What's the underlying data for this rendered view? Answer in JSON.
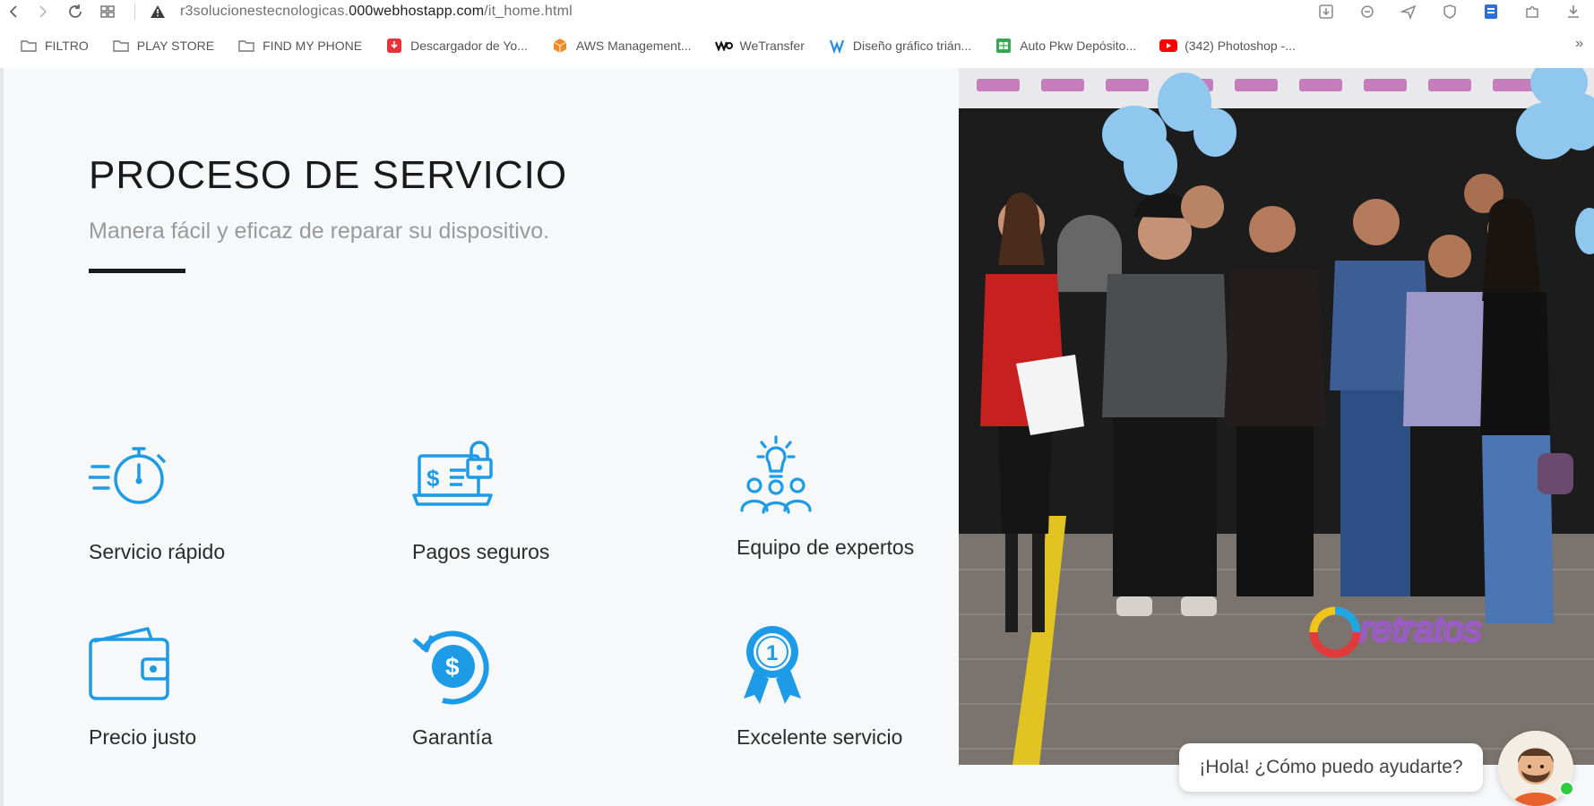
{
  "browser": {
    "url_prefix": "r3solucionestecnologicas.",
    "url_host": "000webhostapp.com",
    "url_path": "/it_home.html",
    "bookmarks": [
      {
        "label": "FILTRO",
        "icon": "folder-icon"
      },
      {
        "label": "PLAY STORE",
        "icon": "folder-icon"
      },
      {
        "label": "FIND MY PHONE",
        "icon": "folder-icon"
      },
      {
        "label": "Descargador de Yo...",
        "icon": "downloader-app-icon"
      },
      {
        "label": "AWS Management...",
        "icon": "aws-cube-icon"
      },
      {
        "label": "WeTransfer",
        "icon": "wetransfer-icon"
      },
      {
        "label": "Diseño gráfico trián...",
        "icon": "design-logo-icon"
      },
      {
        "label": "Auto Pkw Depósito...",
        "icon": "sheet-icon"
      },
      {
        "label": "(342) Photoshop -...",
        "icon": "youtube-icon"
      }
    ],
    "more_label": "»"
  },
  "section": {
    "title": "PROCESO DE SERVICIO",
    "subtitle": "Manera fácil y eficaz de reparar su dispositivo."
  },
  "features": [
    {
      "label": "Servicio rápido",
      "icon": "stopwatch-icon"
    },
    {
      "label": "Pagos seguros",
      "icon": "secure-payment-laptop-icon"
    },
    {
      "label": "Equipo de expertos",
      "icon": "expert-team-icon"
    },
    {
      "label": "Precio justo",
      "icon": "wallet-icon"
    },
    {
      "label": "Garantía",
      "icon": "guarantee-dollar-icon"
    },
    {
      "label": "Excelente servicio",
      "icon": "award-ribbon-icon"
    }
  ],
  "photo": {
    "watermark": "retratos"
  },
  "chat": {
    "message": "¡Hola! ¿Cómo puedo ayudarte?"
  },
  "colors": {
    "accent": "#1e9be6",
    "page_bg": "#f7f8f9",
    "title": "#1a1a1a",
    "subtitle": "#9a9a9a"
  }
}
